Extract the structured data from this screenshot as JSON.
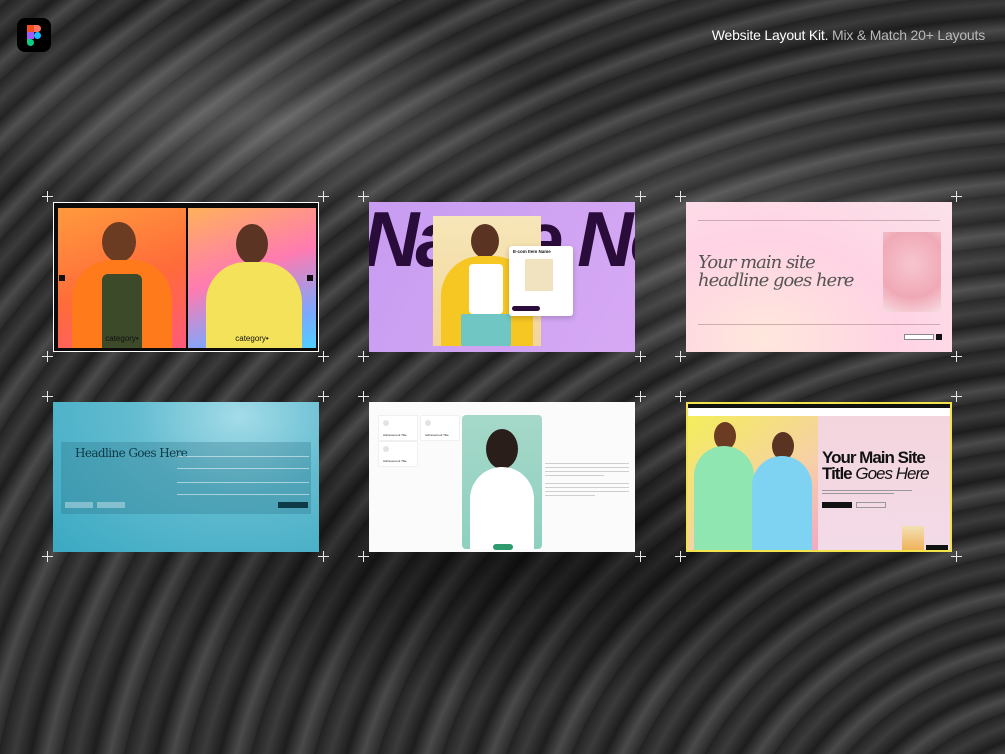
{
  "header": {
    "title": "Website Layout Kit.",
    "subtitle": "Mix & Match 20+ Layouts",
    "logo_icon": "figma-logo-icon"
  },
  "cards": {
    "c1": {
      "label_left": "category•",
      "label_right": "category•"
    },
    "c2": {
      "big_text": "Name No",
      "popup_title": "E-com Item Name"
    },
    "c3": {
      "headline_line1": "Your main site",
      "headline_line2": "headline goes here"
    },
    "c4": {
      "headline": "Headline Goes Here"
    },
    "c5": {
      "tile1": "Achievement Title",
      "tile2": "Achievement Title",
      "tile3": "Achievement Title"
    },
    "c6": {
      "headline_line1": "Your Main Site",
      "headline_line2a": "Title ",
      "headline_line2b": "Goes Here"
    }
  },
  "colors": {
    "c2_accent": "#2a0c3a",
    "c5_badge": "#2f9a6d",
    "c6_border": "#f2e34a"
  }
}
